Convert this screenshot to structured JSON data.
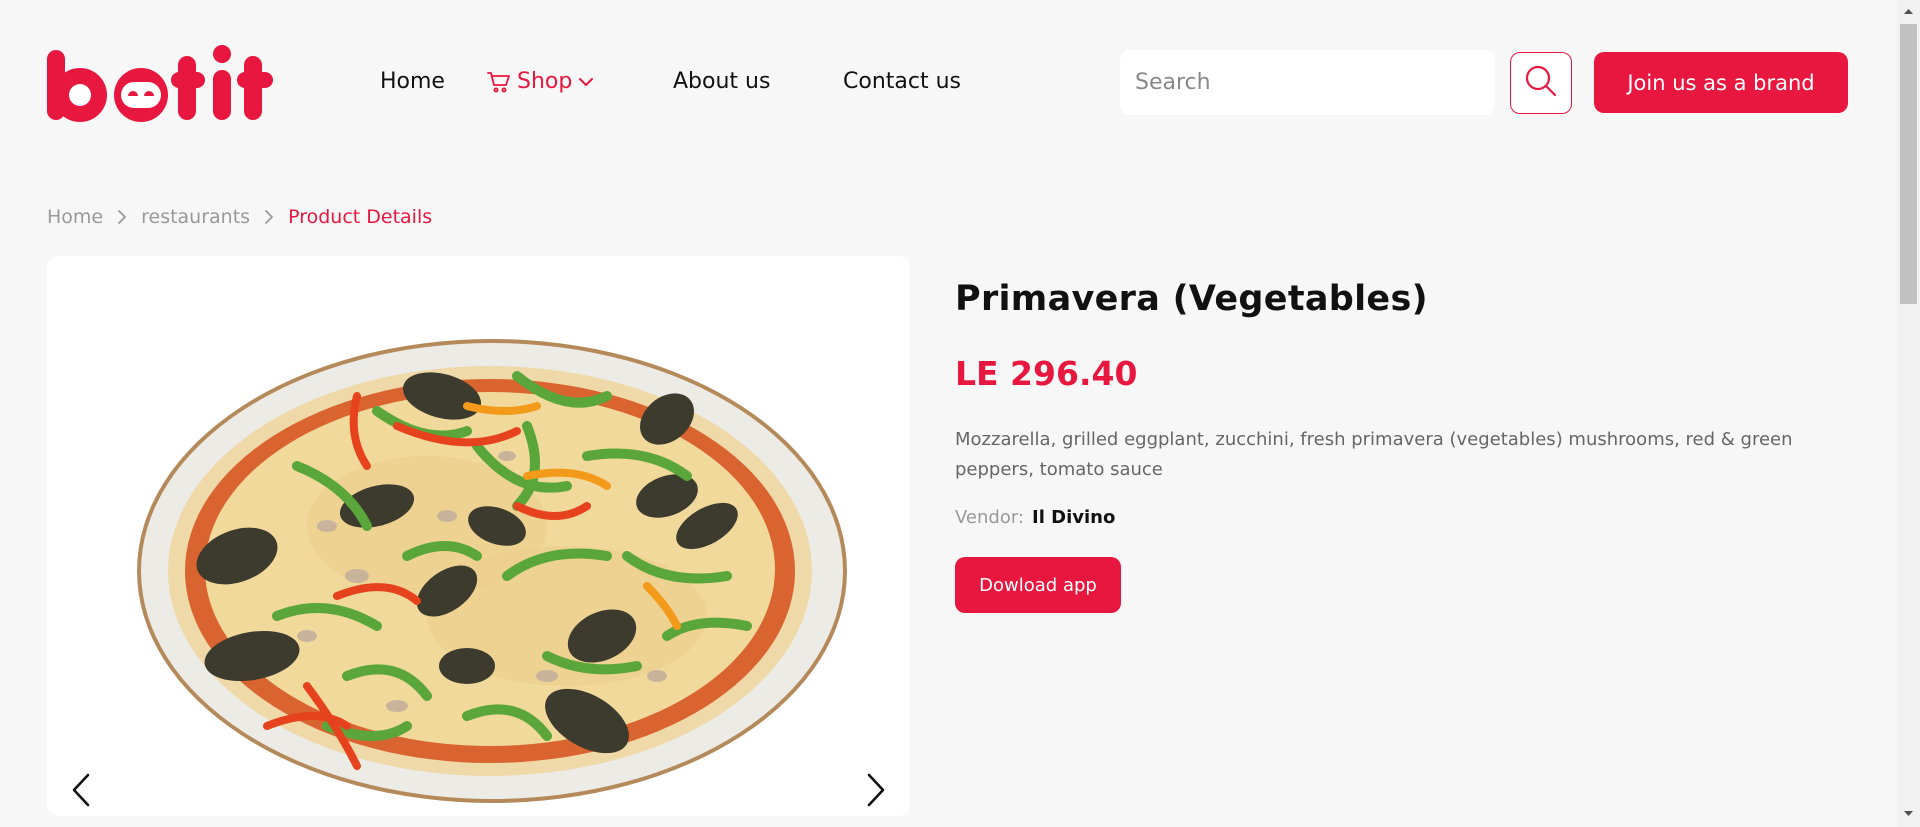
{
  "header": {
    "logo_text": "botit",
    "nav": {
      "home": "Home",
      "shop": "Shop",
      "about": "About us",
      "contact": "Contact us"
    },
    "search_placeholder": "Search",
    "join_button": "Join us as a brand"
  },
  "breadcrumb": {
    "items": [
      "Home",
      "restaurants"
    ],
    "current": "Product Details"
  },
  "product": {
    "title": "Primavera (Vegetables)",
    "price": "LE 296.40",
    "description": "Mozzarella, grilled eggplant, zucchini, fresh primavera (vegetables) mushrooms, red & green peppers, tomato sauce",
    "vendor_label": "Vendor:",
    "vendor_name": "Il Divino",
    "download_button": "Dowload app"
  },
  "colors": {
    "brand": "#e8173f",
    "background": "#f7f7f7",
    "text": "#111111",
    "muted": "#999999"
  },
  "icons": {
    "shop": "cart-icon",
    "shop_dropdown": "chevron-down-icon",
    "search": "search-icon",
    "breadcrumb_separator": "chevron-right-icon",
    "gallery_prev": "chevron-left-icon",
    "gallery_next": "chevron-right-icon"
  }
}
